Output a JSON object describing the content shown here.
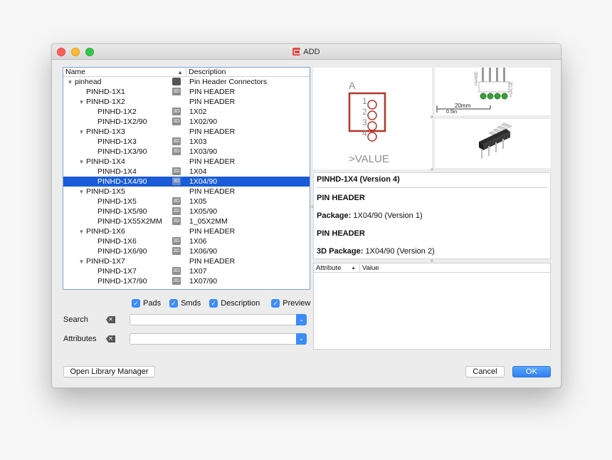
{
  "window": {
    "title": "ADD"
  },
  "tree": {
    "col_name": "Name",
    "col_desc": "Description",
    "rows": [
      {
        "name": "pinhead",
        "desc": "Pin Header Connectors",
        "level": 0,
        "expand": true,
        "icon": "library"
      },
      {
        "name": "PINHD-1X1",
        "desc": "PIN HEADER",
        "level": 1,
        "expand": false,
        "icon": "3d"
      },
      {
        "name": "PINHD-1X2",
        "desc": "PIN HEADER",
        "level": 1,
        "expand": true,
        "icon": ""
      },
      {
        "name": "PINHD-1X2",
        "desc": "1X02",
        "level": 2,
        "expand": false,
        "icon": "3d"
      },
      {
        "name": "PINHD-1X2/90",
        "desc": "1X02/90",
        "level": 2,
        "expand": false,
        "icon": "3d"
      },
      {
        "name": "PINHD-1X3",
        "desc": "PIN HEADER",
        "level": 1,
        "expand": true,
        "icon": ""
      },
      {
        "name": "PINHD-1X3",
        "desc": "1X03",
        "level": 2,
        "expand": false,
        "icon": "3d"
      },
      {
        "name": "PINHD-1X3/90",
        "desc": "1X03/90",
        "level": 2,
        "expand": false,
        "icon": "3d"
      },
      {
        "name": "PINHD-1X4",
        "desc": "PIN HEADER",
        "level": 1,
        "expand": true,
        "icon": ""
      },
      {
        "name": "PINHD-1X4",
        "desc": "1X04",
        "level": 2,
        "expand": false,
        "icon": "3d"
      },
      {
        "name": "PINHD-1X4/90",
        "desc": "1X04/90",
        "level": 2,
        "expand": false,
        "icon": "3d",
        "selected": true
      },
      {
        "name": "PINHD-1X5",
        "desc": "PIN HEADER",
        "level": 1,
        "expand": true,
        "icon": ""
      },
      {
        "name": "PINHD-1X5",
        "desc": "1X05",
        "level": 2,
        "expand": false,
        "icon": "3d"
      },
      {
        "name": "PINHD-1X5/90",
        "desc": "1X05/90",
        "level": 2,
        "expand": false,
        "icon": "3d"
      },
      {
        "name": "PINHD-1X55X2MM",
        "desc": "1_05X2MM",
        "level": 2,
        "expand": false,
        "icon": "3d"
      },
      {
        "name": "PINHD-1X6",
        "desc": "PIN HEADER",
        "level": 1,
        "expand": true,
        "icon": ""
      },
      {
        "name": "PINHD-1X6",
        "desc": "1X06",
        "level": 2,
        "expand": false,
        "icon": "3d"
      },
      {
        "name": "PINHD-1X6/90",
        "desc": "1X06/90",
        "level": 2,
        "expand": false,
        "icon": "3d"
      },
      {
        "name": "PINHD-1X7",
        "desc": "PIN HEADER",
        "level": 1,
        "expand": true,
        "icon": ""
      },
      {
        "name": "PINHD-1X7",
        "desc": "1X07",
        "level": 2,
        "expand": false,
        "icon": "3d"
      },
      {
        "name": "PINHD-1X7/90",
        "desc": "1X07/90",
        "level": 2,
        "expand": false,
        "icon": "3d"
      }
    ],
    "badge_3d": "3D"
  },
  "filters": {
    "pads": "Pads",
    "smds": "Smds",
    "description": "Description",
    "preview": "Preview",
    "search_label": "Search",
    "search_value": "",
    "attributes_label": "Attributes",
    "attributes_value": ""
  },
  "preview": {
    "symbol_name": "A",
    "symbol_value": ">VALUE",
    "pin_numbers": [
      "1",
      "2",
      "3",
      "4"
    ],
    "pkg_name": ">NAME",
    "pkg_value": ">VALUE",
    "scale_label": "20mm",
    "scale_label2": "0.5in"
  },
  "info": {
    "heading": "PINHD-1X4 (Version 4)",
    "desc1": "PIN HEADER",
    "package_label": "Package:",
    "package_value": "1X04/90 (Version 1)",
    "desc2": "PIN HEADER",
    "package3d_label": "3D Package:",
    "package3d_value": "1X04/90 (Version 2)"
  },
  "attributes": {
    "col_attr": "Attribute",
    "col_value": "Value"
  },
  "buttons": {
    "library_manager": "Open Library Manager",
    "cancel": "Cancel",
    "ok": "OK"
  },
  "colors": {
    "selection": "#1a5cd8",
    "accent": "#3b8cf6",
    "symbol_stroke": "#b3342b"
  }
}
